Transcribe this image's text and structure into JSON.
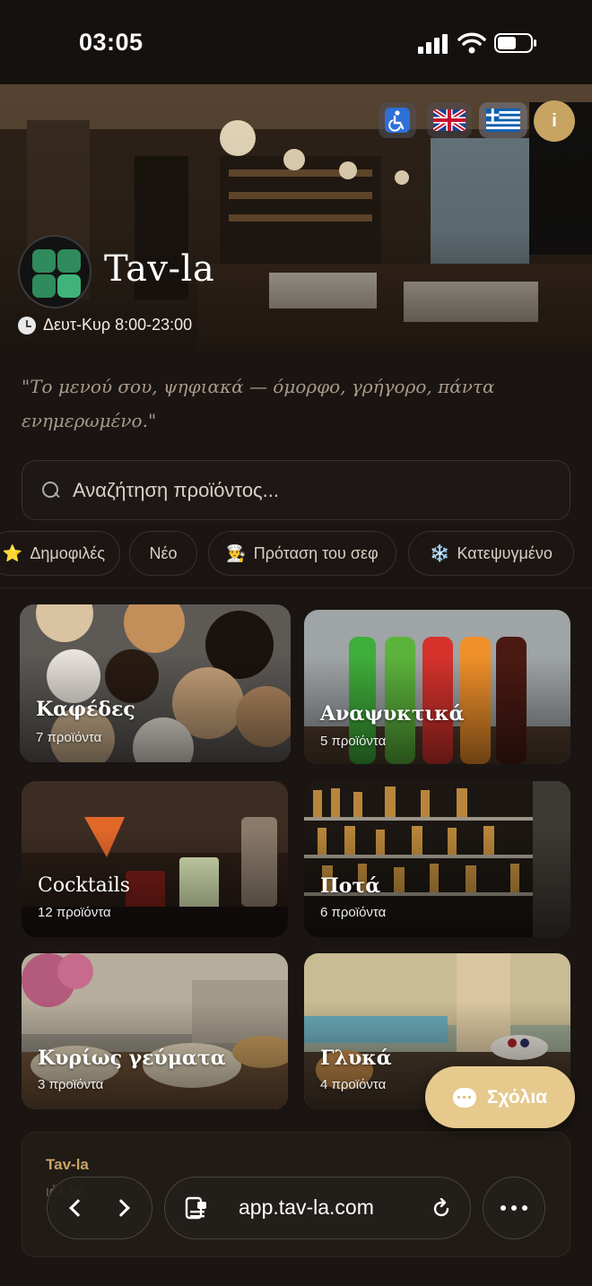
{
  "status_bar": {
    "time": "03:05"
  },
  "header": {
    "brand": "Tav-la",
    "hours": "Δευτ-Κυρ 8:00-23:00",
    "buttons": {
      "accessibility": "accessibility-icon",
      "english": "uk-flag-icon",
      "greek": "greek-flag-icon",
      "info": "i"
    }
  },
  "tagline": "\"Το μενού σου, ψηφιακά — όμορφο, γρήγορο, πάντα ενημερωμένο.\"",
  "search": {
    "placeholder": "Αναζήτηση προϊόντος..."
  },
  "filters": [
    {
      "icon": "⭐",
      "label": "Δημοφιλές"
    },
    {
      "icon": "",
      "label": "Νέο"
    },
    {
      "icon": "👨‍🍳",
      "label": "Πρόταση του σεφ"
    },
    {
      "icon": "❄️",
      "label": "Κατεψυγμένο"
    }
  ],
  "categories": [
    {
      "title": "Καφέδες",
      "count": "7 προϊόντα"
    },
    {
      "title": "Αναψυκτικά",
      "count": "5 προϊόντα"
    },
    {
      "title": "Cocktails",
      "count": "12 προϊόντα"
    },
    {
      "title": "Ποτά",
      "count": "6 προϊόντα"
    },
    {
      "title": "Κυρίως γεύματα",
      "count": "3 προϊόντα"
    },
    {
      "title": "Γλυκά",
      "count": "4 προϊόντα"
    }
  ],
  "feedback": {
    "label": "Σχόλια"
  },
  "footer": {
    "name": "Tav-la",
    "faint_line": "ιόλ                    56"
  },
  "browser": {
    "url": "app.tav-la.com"
  },
  "colors": {
    "accent": "#c8a463",
    "background": "#1a1512",
    "fab": "#e6c98d"
  }
}
